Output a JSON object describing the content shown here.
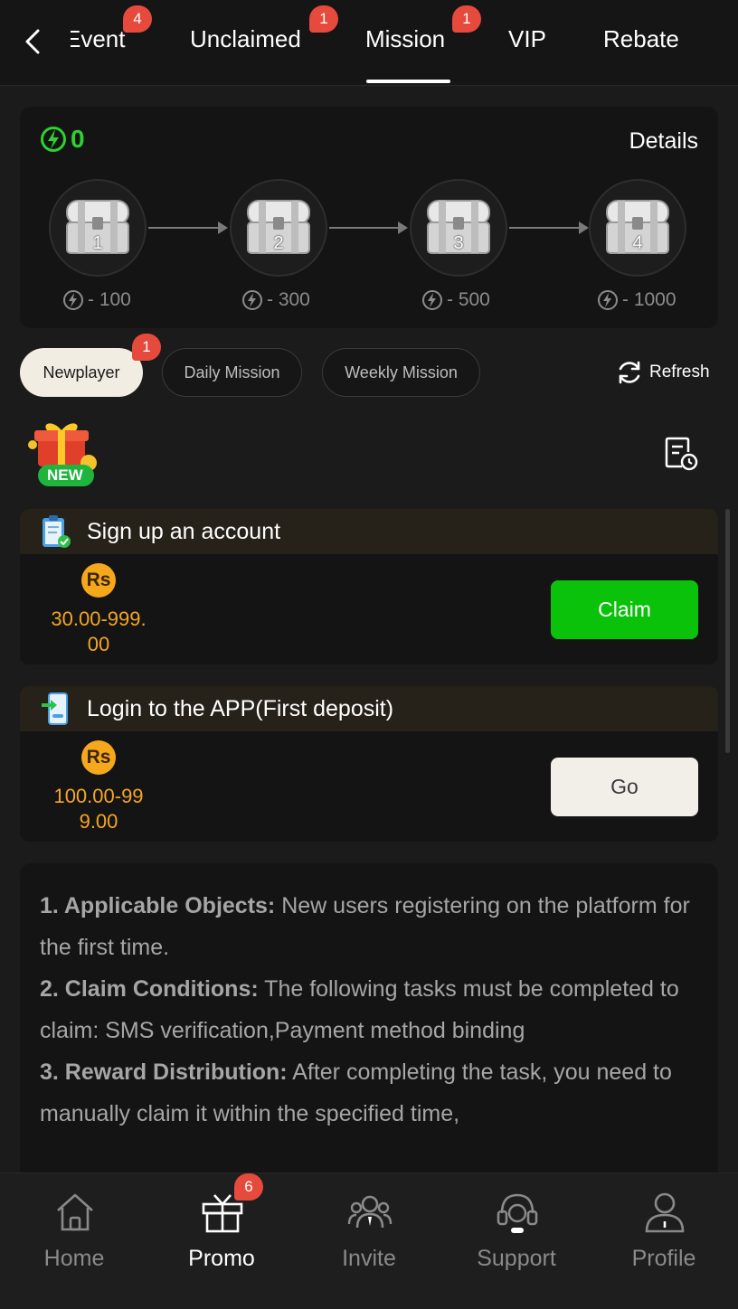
{
  "topnav": {
    "tabs": [
      {
        "label": "Event",
        "badge": "4"
      },
      {
        "label": "Unclaimed",
        "badge": "1"
      },
      {
        "label": "Mission",
        "badge": "1"
      },
      {
        "label": "VIP"
      },
      {
        "label": "Rebate"
      }
    ],
    "active_tab": "Mission"
  },
  "chests": {
    "energy": "0",
    "details_label": "Details",
    "items": [
      {
        "num": "1",
        "cost": "- 100"
      },
      {
        "num": "2",
        "cost": "- 300"
      },
      {
        "num": "3",
        "cost": "- 500"
      },
      {
        "num": "4",
        "cost": "- 1000"
      }
    ]
  },
  "mission_tabs": {
    "items": [
      {
        "label": "Newplayer",
        "badge": "1"
      },
      {
        "label": "Daily Mission"
      },
      {
        "label": "Weekly Mission"
      }
    ],
    "active": "Newplayer",
    "refresh_label": "Refresh"
  },
  "new_badge": "NEW",
  "missions": [
    {
      "title": "Sign up an account",
      "currency": "Rs",
      "reward_line1": "30.00-999.",
      "reward_line2": "00",
      "button": "Claim"
    },
    {
      "title": "Login to the APP(First deposit)",
      "currency": "Rs",
      "reward_line1": "100.00-99",
      "reward_line2": "9.00",
      "button": "Go"
    }
  ],
  "rules": [
    {
      "head": "1. Applicable Objects:",
      "body": " New users registering on the platform for the first time."
    },
    {
      "head": "2. Claim Conditions:",
      "body": " The following tasks must be completed to claim: SMS verification,Payment method binding"
    },
    {
      "head": "3. Reward Distribution:",
      "body": " After completing the task, you need to manually claim it within the specified time,"
    }
  ],
  "bottomnav": [
    {
      "label": "Home",
      "icon": "home-icon"
    },
    {
      "label": "Promo",
      "icon": "gift-icon",
      "badge": "6"
    },
    {
      "label": "Invite",
      "icon": "invite-icon"
    },
    {
      "label": "Support",
      "icon": "headset-icon"
    },
    {
      "label": "Profile",
      "icon": "profile-icon"
    }
  ],
  "colors": {
    "accent_green": "#0ac20a",
    "energy_green": "#2ed12e",
    "reward_orange": "#f5a623",
    "badge_red": "#e64a3c",
    "background": "#1b1b1b"
  }
}
